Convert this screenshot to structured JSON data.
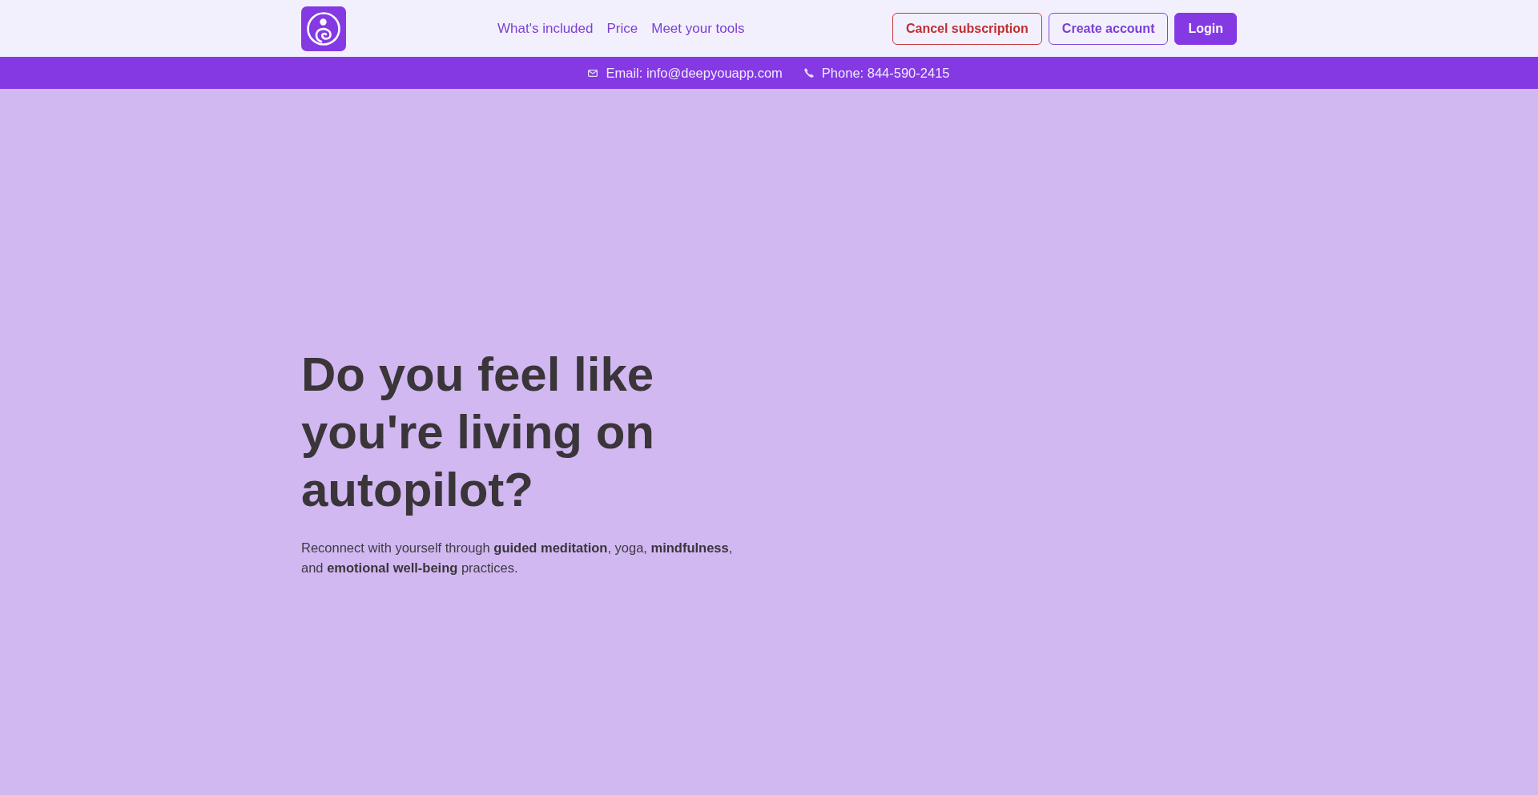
{
  "header": {
    "nav": [
      "What's included",
      "Price",
      "Meet your tools"
    ],
    "buttons": [
      {
        "label": "Cancel subscription",
        "kind": "danger"
      },
      {
        "label": "Create account",
        "kind": "outline"
      },
      {
        "label": "Login",
        "kind": "primary"
      }
    ]
  },
  "contact_bar": {
    "items": [
      {
        "kind": "email",
        "text": "Email: info@deepyouapp.com"
      },
      {
        "kind": "phone",
        "text": "Phone: 844-590-2415"
      }
    ]
  },
  "hero": {
    "title": "Do you feel like you're living on autopilot?",
    "subtitle": "Reconnect with yourself through **guided meditation**, yoga, **mindfulness**, and **emotional well-being** practices."
  }
}
